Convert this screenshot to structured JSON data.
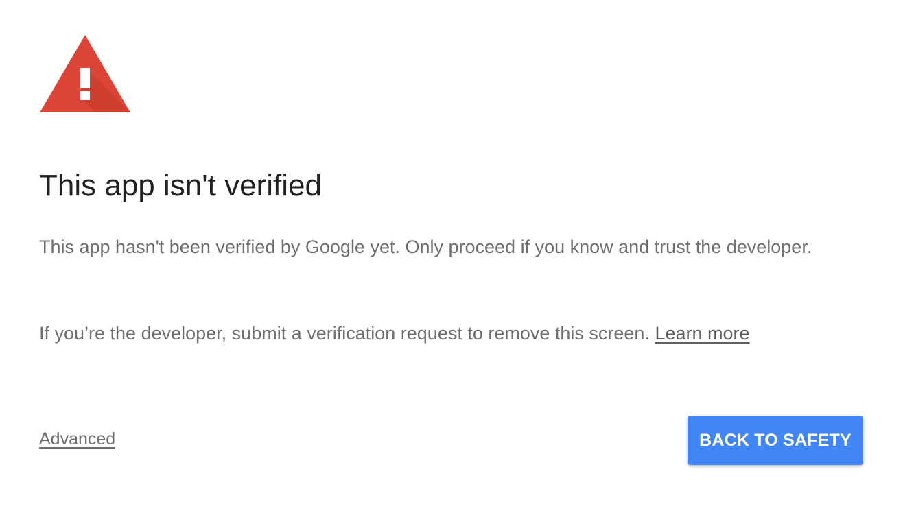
{
  "icon": {
    "name": "warning-triangle-icon",
    "color": "#db4437",
    "glyph": "!"
  },
  "heading": {
    "title": "This app isn't verified"
  },
  "body": {
    "paragraph1": "This app hasn't been verified by Google yet. Only proceed if you know and trust the developer.",
    "paragraph2_text": "If you’re the developer, submit a verification request to remove this screen.",
    "learn_more_label": "Learn more"
  },
  "footer": {
    "advanced_label": "Advanced",
    "back_button_label": "BACK TO SAFETY"
  },
  "colors": {
    "primary": "#4285f4",
    "warning": "#db4437",
    "title_text": "#212121",
    "body_text": "#6e6e6e"
  }
}
